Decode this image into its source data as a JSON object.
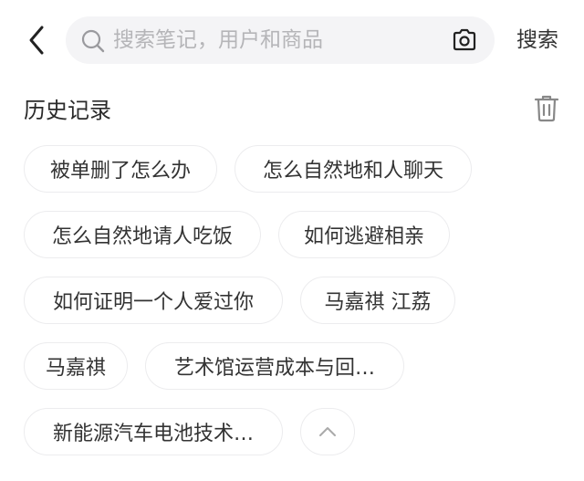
{
  "header": {
    "back_icon": "chevron-left-icon",
    "search": {
      "placeholder": "搜索笔记，用户和商品",
      "value": "",
      "search_icon": "search-icon",
      "camera_icon": "camera-icon"
    },
    "search_button": "搜索"
  },
  "history": {
    "title": "历史记录",
    "clear_icon": "trash-icon",
    "items": [
      "被单删了怎么办",
      "怎么自然地和人聊天",
      "怎么自然地请人吃饭",
      "如何逃避相亲",
      "如何证明一个人爱过你",
      "马嘉祺 江荔",
      "马嘉祺",
      "艺术馆运营成本与回…",
      "新能源汽车电池技术…"
    ],
    "collapse_icon": "chevron-up-icon"
  },
  "colors": {
    "background": "#ffffff",
    "search_bg": "#f4f4f6",
    "placeholder": "#b5b5b8",
    "chip_border": "#ececee",
    "text": "#333333"
  }
}
